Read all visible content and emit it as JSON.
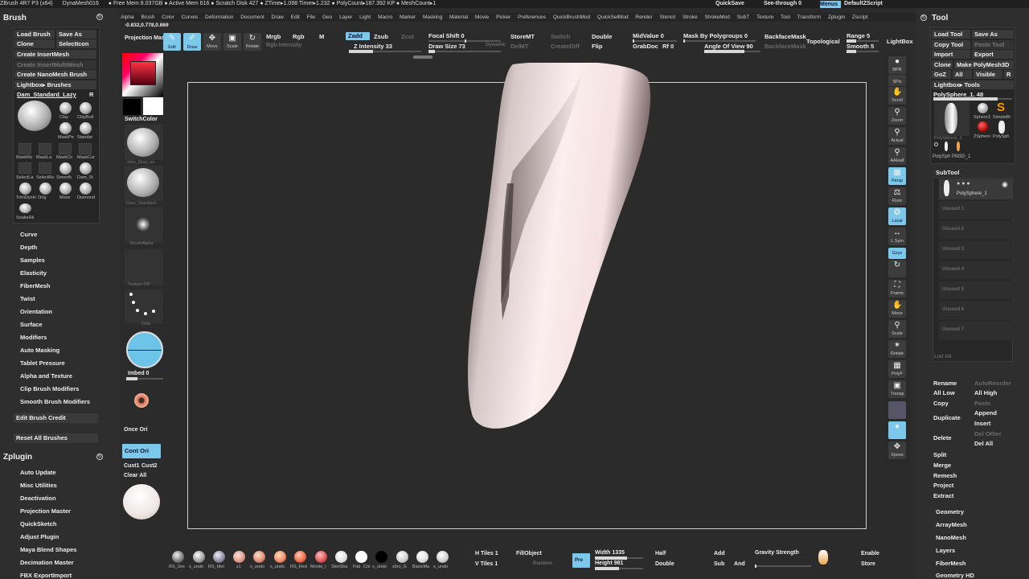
{
  "titlebar": [
    "ZBrush 4R7 P3 (x64)",
    "DynaMesh016",
    "● Free Mem 8.037GB ● Active Mem 616 ● Scratch Disk 427 ● ZTime▸1.098 Timer▸1.232 ● PolyCount▸187.392 KP ● MeshCount▸1",
    "QuickSave",
    "See-through 0",
    "Menus",
    "DefaultZScript"
  ],
  "menus": [
    "Alpha",
    "Brush",
    "Color",
    "Curves",
    "Deformation",
    "Document",
    "Draw",
    "Edit",
    "File",
    "Geo",
    "Layer",
    "Light",
    "Macro",
    "Marker",
    "Masking",
    "Material",
    "Movie",
    "Picker",
    "Preferences",
    "QuickBrushMod",
    "QuickSelMod",
    "Render",
    "Stencil",
    "Stroke",
    "StrokeMod",
    "SubT",
    "Texture",
    "Tool",
    "Transform",
    "Zplugin",
    "Zscript"
  ],
  "coords": "-0.832,0.778,0.869",
  "brush_panel": {
    "title": "Brush",
    "buttons": [
      "Load Brush",
      "Save As",
      "Clone",
      "SelectIcon",
      "Create InsertMesh",
      "Create InsertMultiMesh",
      "Create NanoMesh Brush",
      "Lightbox▸ Brushes"
    ],
    "current": "Dam_Standard_Lazy",
    "r_label": "R",
    "brush_names": [
      "Clay",
      "ClayBuil",
      "MaskPe",
      "Standar",
      "MaskRe",
      "MaskLa",
      "MaskCir",
      "MaskCur",
      "SelectLa",
      "SelectRe",
      "Smooth",
      "Dam_St",
      "TrimDynH",
      "Orig",
      "Move",
      "Diamond",
      "SnakeHk"
    ],
    "sections": [
      "Curve",
      "Depth",
      "Samples",
      "Elasticity",
      "FiberMesh",
      "Twist",
      "Orientation",
      "Surface",
      "Modifiers",
      "Auto Masking",
      "Tablet Pressure",
      "Alpha and Texture",
      "Clip Brush Modifiers",
      "Smooth Brush Modifiers"
    ],
    "edit_credit": "Edit Brush Credit",
    "reset": "Reset All Brushes"
  },
  "zplugin_panel": {
    "title": "Zplugin",
    "items": [
      "Auto Update",
      "Misc Utilities",
      "Deactivation",
      "Projection Master",
      "QuickSketch",
      "Adjust Plugin",
      "Maya Blend Shapes",
      "Decimation Master",
      "FBX ExportImport"
    ]
  },
  "shelf": {
    "switch_color": "SwitchColor",
    "labels": [
      "zbro_Grav_ex",
      "Dam_Standard",
      "BrushAlpha",
      "Texture Off",
      "Dots"
    ],
    "imbed": "Imbed 0",
    "once_ori": "Once Ori",
    "cont_ori": "Cont Ori",
    "cust1": "Cust1",
    "cust2": "Cust2",
    "clear_all": "Clear All"
  },
  "top_toolbar": {
    "projection_master": "Projection Master",
    "edit": "Edit",
    "draw": "Draw",
    "move": "Move",
    "scale": "Scale",
    "rotate": "Rotate",
    "mrgb": "Mrgb",
    "rgb": "Rgb",
    "m": "M",
    "rgb_intensity": "Rgb Intensity",
    "zadd": "Zadd",
    "zsub": "Zsub",
    "zcut": "Zcut",
    "z_intensity": "Z Intensity 33",
    "focal_shift": "Focal Shift 0",
    "draw_size": "Draw Size 73",
    "dynamic": "Dynamic",
    "storemt": "StoreMT",
    "delmt": "DelMT",
    "switch": "Switch",
    "creatediff": "CreateDiff",
    "double": "Double",
    "flip": "Flip",
    "midvalue": "MidValue 0",
    "grabdoc": "GrabDoc",
    "rf": "Rf 0",
    "mask_polygroups": "Mask By Polygroups 0",
    "angle_of_view": "Angle Of View 90",
    "backfacemask": "BackfaceMask",
    "backfacemask2": "BackfaceMask",
    "topological": "Topological",
    "range": "Range 5",
    "smooth": "Smooth 5",
    "lightbox": "LightBox"
  },
  "right_icons": [
    "BPR",
    "SPix",
    "Scroll",
    "Zoom",
    "Actual",
    "AAHalf",
    "Persp",
    "Floor",
    "Local",
    "L.Sym",
    "Gxyz",
    "",
    "Frame",
    "Move",
    "Scale",
    "Rotate",
    "PolyF",
    "Transp",
    "Ghost",
    "Solo",
    "Xpose"
  ],
  "tool_panel": {
    "title": "Tool",
    "buttons": [
      "Load Tool",
      "Save As",
      "Copy Tool",
      "Paste Tool",
      "Import",
      "Export",
      "Clone",
      "Make PolyMesh3D",
      "GoZ",
      "All",
      "Visible",
      "R",
      "Lightbox▸ Tools"
    ],
    "current": "PolySphere_1. 48",
    "thumbs": [
      "PolySphere_1",
      "Sphere3",
      "SimpleBr",
      "ZSphere",
      "PolySph"
    ],
    "current2": "PolySph PM3D_1",
    "subtool_title": "SubTool",
    "subtool_name": "PolySphere_1",
    "unused": [
      "Unused 1",
      "Unused 2",
      "Unused 3",
      "Unused 4",
      "Unused 5",
      "Unused 6",
      "Unused 7"
    ],
    "list_all": "List All",
    "ops": [
      "Rename",
      "AutoReorder",
      "All Low",
      "All High",
      "Copy",
      "Paste",
      "Duplicate",
      "Append",
      "Insert",
      "Delete",
      "Del Other",
      "Del All",
      "Split",
      "Merge",
      "Remesh",
      "Project",
      "Extract"
    ],
    "sections": [
      "Geometry",
      "ArrayMesh",
      "NanoMesh",
      "Layers",
      "FiberMesh",
      "Geometry HD"
    ]
  },
  "bottom": {
    "materials": [
      "RS_Gre",
      "x_undo",
      "RS_Met",
      "z1",
      "x_undo",
      "x_undo",
      "RS_Red",
      "Monte_l",
      "SkinSha",
      "Flat",
      "Col",
      "x_undo",
      "zbro_G",
      "BasicMa",
      "x_undo"
    ],
    "htiles": "H Tiles 1",
    "vtiles": "V Tiles 1",
    "fillobject": "FillObject",
    "random": "Random",
    "pro": "Pro",
    "width": "Width 1335",
    "height": "Height 981",
    "half": "Half",
    "double": "Double",
    "add": "Add",
    "sub": "Sub",
    "and": "And",
    "gravity": "Gravity Strength",
    "enable": "Enable",
    "store": "Store"
  },
  "colors": {
    "accent": "#7bc8ea",
    "bg": "#2b2b2b",
    "panel": "#2e2e2e"
  }
}
